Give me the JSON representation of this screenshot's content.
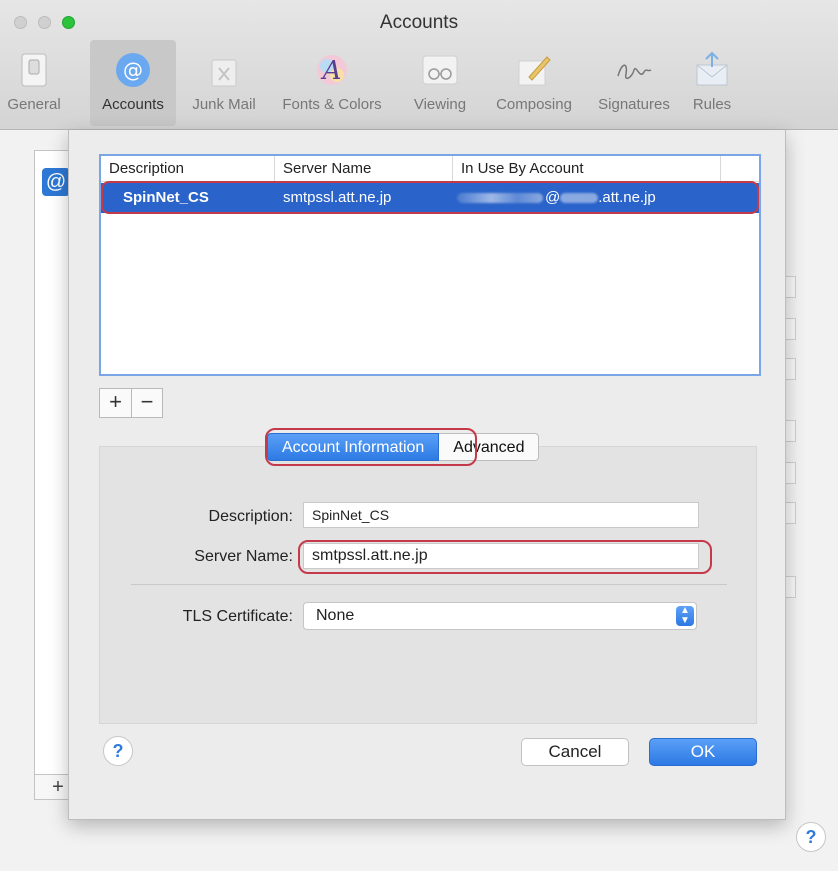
{
  "window": {
    "title": "Accounts"
  },
  "toolbar": {
    "items": [
      {
        "label": "General",
        "icon": "general-switch-icon"
      },
      {
        "label": "Accounts",
        "icon": "at-sign-icon",
        "selected": true
      },
      {
        "label": "Junk Mail",
        "icon": "junk-mail-icon"
      },
      {
        "label": "Fonts & Colors",
        "icon": "fonts-colors-icon"
      },
      {
        "label": "Viewing",
        "icon": "glasses-icon"
      },
      {
        "label": "Composing",
        "icon": "pencil-icon"
      },
      {
        "label": "Signatures",
        "icon": "signature-icon"
      },
      {
        "label": "Rules",
        "icon": "rules-envelope-icon"
      }
    ]
  },
  "sheet": {
    "table": {
      "headers": [
        "Description",
        "Server Name",
        "In Use By Account"
      ],
      "rows": [
        {
          "description": "SpinNet_CS",
          "server": "smtpssl.att.ne.jp",
          "account": ".att.ne.jp",
          "account_at": "@"
        }
      ]
    },
    "add_label": "+",
    "remove_label": "−",
    "tabs": {
      "account_info": "Account Information",
      "advanced": "Advanced"
    },
    "form": {
      "description_label": "Description:",
      "description_value": "SpinNet_CS",
      "server_label": "Server Name:",
      "server_value": "smtpssl.att.ne.jp",
      "tls_label": "TLS Certificate:",
      "tls_value": "None"
    },
    "help_label": "?",
    "cancel_label": "Cancel",
    "ok_label": "OK"
  },
  "background": {
    "at_label": "@",
    "plus_label": "+",
    "help_label": "?"
  },
  "colors": {
    "selection": "#2a63c9",
    "accent": "#2d7ae4",
    "annotation": "#c43a4a"
  }
}
